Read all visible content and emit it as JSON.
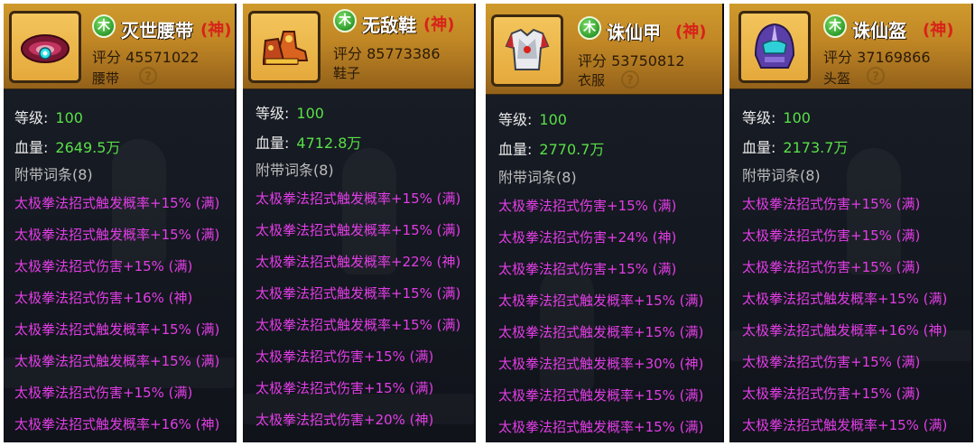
{
  "labels": {
    "level": "等级:",
    "hp": "血量:",
    "affix_header": "附带词条(8)",
    "help_glyph": "?",
    "element_glyph": "木"
  },
  "panels": [
    {
      "name": "灭世腰带",
      "grade": "(神)",
      "score": "评分 45571022",
      "type": "腰带",
      "level": "100",
      "hp": "2649.5万",
      "affixes": [
        "太极拳法招式触发概率+15% (满)",
        "太极拳法招式触发概率+15% (满)",
        "太极拳法招式伤害+15% (满)",
        "太极拳法招式伤害+16% (神)",
        "太极拳法招式触发概率+15% (满)",
        "太极拳法招式触发概率+15% (满)",
        "太极拳法招式伤害+15% (满)",
        "太极拳法招式触发概率+16% (神)"
      ]
    },
    {
      "name": "无敌鞋",
      "grade": "(神)",
      "score": "评分 85773386",
      "type": "鞋子",
      "level": "100",
      "hp": "4712.8万",
      "affixes": [
        "太极拳法招式触发概率+15% (满)",
        "太极拳法招式触发概率+15% (满)",
        "太极拳法招式触发概率+22% (神)",
        "太极拳法招式触发概率+15% (满)",
        "太极拳法招式触发概率+15% (满)",
        "太极拳法招式伤害+15% (满)",
        "太极拳法招式伤害+15% (满)",
        "太极拳法招式伤害+20% (神)"
      ]
    },
    {
      "name": "诛仙甲",
      "grade": "(神)",
      "score": "评分 53750812",
      "type": "衣服",
      "level": "100",
      "hp": "2770.7万",
      "affixes": [
        "太极拳法招式伤害+15% (满)",
        "太极拳法招式伤害+24% (神)",
        "太极拳法招式伤害+15% (满)",
        "太极拳法招式触发概率+15% (满)",
        "太极拳法招式触发概率+15% (满)",
        "太极拳法招式触发概率+30% (神)",
        "太极拳法招式触发概率+15% (满)",
        "太极拳法招式触发概率+15% (满)"
      ]
    },
    {
      "name": "诛仙盔",
      "grade": "(神)",
      "score": "评分 37169866",
      "type": "头盔",
      "level": "100",
      "hp": "2173.7万",
      "affixes": [
        "太极拳法招式伤害+15% (满)",
        "太极拳法招式伤害+15% (满)",
        "太极拳法招式伤害+15% (满)",
        "太极拳法招式触发概率+15% (满)",
        "太极拳法招式触发概率+16% (神)",
        "太极拳法招式伤害+15% (满)",
        "太极拳法招式伤害+15% (满)",
        "太极拳法招式触发概率+15% (满)"
      ]
    }
  ],
  "colors": {
    "header_gold": "#c08625",
    "grade_red": "#d8221a",
    "value_green": "#58e046",
    "affix_purple": "#e23de6",
    "element_green": "#2f9a2c"
  }
}
